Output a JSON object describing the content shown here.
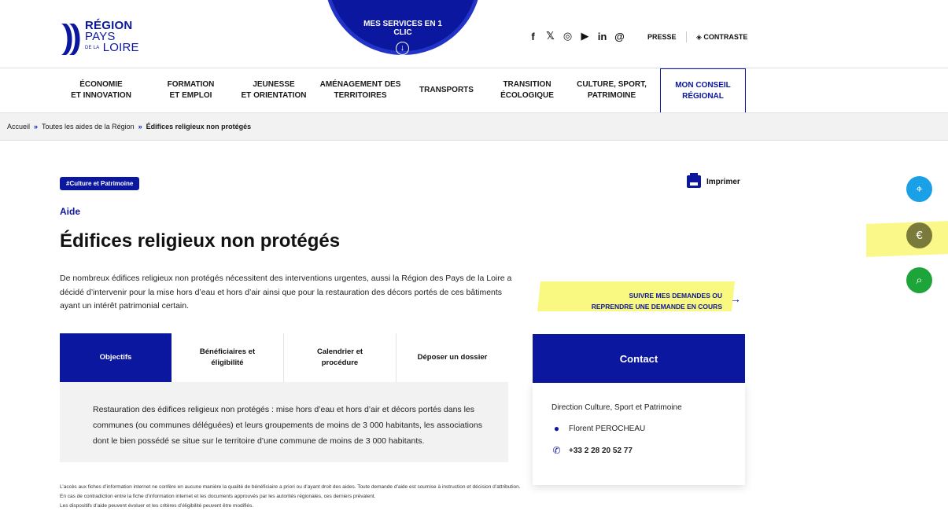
{
  "header": {
    "logo": {
      "line1": "RÉGION",
      "line2": "PAYS",
      "line3_small": "DE LA",
      "line3": "LOIRE"
    },
    "services": {
      "label": "MES SERVICES EN 1 CLIC",
      "arrow": "↓"
    },
    "social_icons": [
      "facebook-icon",
      "x-icon",
      "instagram-icon",
      "youtube-icon",
      "linkedin-icon",
      "threads-icon"
    ],
    "social_glyphs": [
      "f",
      "𝕏",
      "◎",
      "▶",
      "in",
      "@"
    ],
    "presse": "PRESSE",
    "contraste": "◈ CONTRASTE"
  },
  "nav": [
    {
      "label": "ÉCONOMIE\nET INNOVATION"
    },
    {
      "label": "FORMATION\nET EMPLOI"
    },
    {
      "label": "JEUNESSE\nET ORIENTATION"
    },
    {
      "label": "AMÉNAGEMENT DES\nTERRITOIRES"
    },
    {
      "label": "TRANSPORTS"
    },
    {
      "label": "TRANSITION\nÉCOLOGIQUE"
    },
    {
      "label": "CULTURE, SPORT,\nPATRIMOINE"
    },
    {
      "label": "MON CONSEIL\nRÉGIONAL"
    }
  ],
  "breadcrumb": {
    "home": "Accueil",
    "chev": "»",
    "level1": "Toutes les aides de la Région",
    "current": "Édifices religieux non protégés"
  },
  "content": {
    "tag": "#Culture et Patrimoine",
    "print": "Imprimer",
    "kind": "Aide",
    "title": "Édifices religieux non protégés",
    "intro": "De nombreux édifices religieux non protégés nécessitent des interventions urgentes, aussi la Région des Pays de la Loire a décidé d’intervenir pour la mise hors d’eau et hors d’air ainsi que pour la restauration des décors portés de ces bâtiments ayant un intérêt patrimonial certain.",
    "suivre": "SUIVRE MES DEMANDES OU\nREPRENDRE UNE DEMANDE EN COURS",
    "suivre_arrow": "→",
    "tabs": [
      "Objectifs",
      "Bénéficiaires et\néligibilité",
      "Calendrier et\nprocédure",
      "Déposer un dossier"
    ],
    "tab_text": "Restauration des édifices religieux non protégés : mise hors d’eau et hors d’air et décors portés dans les communes (ou communes déléguées) et leurs groupements de moins de 3 000 habitants, les associations dont le bien possédé se situe sur le territoire d’une commune de moins de 3 000 habitants.",
    "disclaimer": "L’accès aux fiches d’information internet ne confère en aucune manière la qualité de bénéficiaire a priori ou d’ayant droit des aides. Toute demande d’aide est soumise à instruction et décision d’attribution. En cas de contradiction entre la fiche d’information internet et les documents approuvés par les autorités régionales, ces derniers prévalent.\nLes dispositifs d’aide peuvent évoluer et les critères d’éligibilité peuvent être modifiés."
  },
  "contact": {
    "title": "Contact",
    "direction": "Direction Culture, Sport et Patrimoine",
    "person": "Florent PEROCHEAU",
    "phone": "+33 2 28 20 52 77"
  },
  "floating": [
    "location-icon",
    "aid-hand-icon",
    "search-chat-icon"
  ],
  "colors": {
    "brand": "#0c17a0",
    "highlight": "#f8f773",
    "float1": "#1aa0e6",
    "float3": "#1da53a"
  }
}
